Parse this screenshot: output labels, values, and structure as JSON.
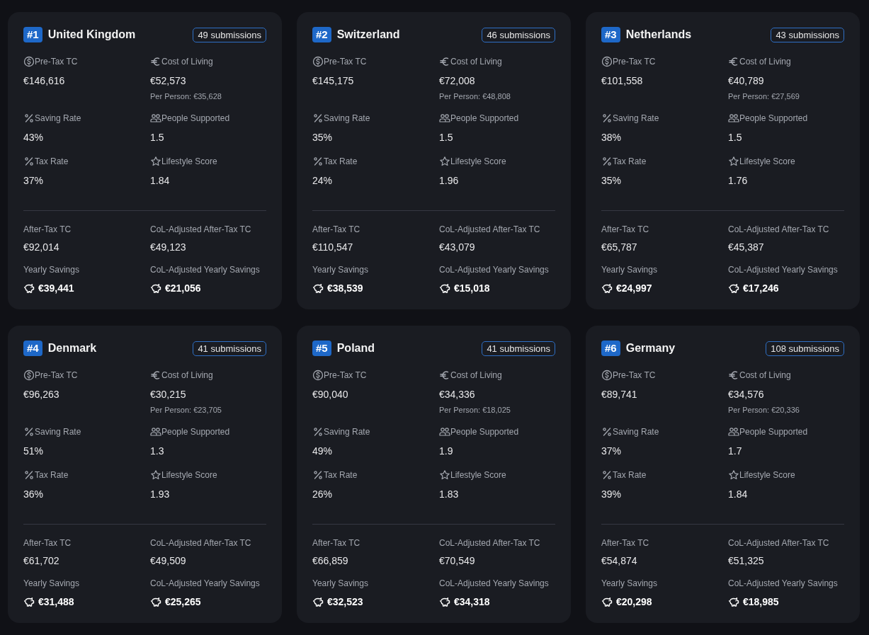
{
  "cards": [
    {
      "rank": "#1",
      "country": "United Kingdom",
      "submissions": "49 submissions",
      "metrics": [
        {
          "kind": "dollar",
          "label": "Pre-Tax TC",
          "value": "€146,616"
        },
        {
          "kind": "euro",
          "label": "Cost of Living",
          "value": "€52,573",
          "note": "Per Person: €35,628"
        },
        {
          "kind": "percent",
          "label": "Saving Rate",
          "value": "43%"
        },
        {
          "kind": "people",
          "label": "People Supported",
          "value": "1.5"
        },
        {
          "kind": "percent",
          "label": "Tax Rate",
          "value": "37%"
        },
        {
          "kind": "star",
          "label": "Lifestyle Score",
          "value": "1.84"
        }
      ],
      "summary": [
        {
          "kind": "plain",
          "label": "After-Tax TC",
          "value": "€92,014"
        },
        {
          "kind": "plain",
          "label": "CoL-Adjusted After-Tax TC",
          "value": "€49,123"
        },
        {
          "kind": "savings",
          "label": "Yearly Savings",
          "value": "€39,441"
        },
        {
          "kind": "savings",
          "label": "CoL-Adjusted Yearly Savings",
          "value": "€21,056"
        }
      ]
    },
    {
      "rank": "#2",
      "country": "Switzerland",
      "submissions": "46 submissions",
      "metrics": [
        {
          "kind": "dollar",
          "label": "Pre-Tax TC",
          "value": "€145,175"
        },
        {
          "kind": "euro",
          "label": "Cost of Living",
          "value": "€72,008",
          "note": "Per Person: €48,808"
        },
        {
          "kind": "percent",
          "label": "Saving Rate",
          "value": "35%"
        },
        {
          "kind": "people",
          "label": "People Supported",
          "value": "1.5"
        },
        {
          "kind": "percent",
          "label": "Tax Rate",
          "value": "24%"
        },
        {
          "kind": "star",
          "label": "Lifestyle Score",
          "value": "1.96"
        }
      ],
      "summary": [
        {
          "kind": "plain",
          "label": "After-Tax TC",
          "value": "€110,547"
        },
        {
          "kind": "plain",
          "label": "CoL-Adjusted After-Tax TC",
          "value": "€43,079"
        },
        {
          "kind": "savings",
          "label": "Yearly Savings",
          "value": "€38,539"
        },
        {
          "kind": "savings",
          "label": "CoL-Adjusted Yearly Savings",
          "value": "€15,018"
        }
      ]
    },
    {
      "rank": "#3",
      "country": "Netherlands",
      "submissions": "43 submissions",
      "metrics": [
        {
          "kind": "dollar",
          "label": "Pre-Tax TC",
          "value": "€101,558"
        },
        {
          "kind": "euro",
          "label": "Cost of Living",
          "value": "€40,789",
          "note": "Per Person: €27,569"
        },
        {
          "kind": "percent",
          "label": "Saving Rate",
          "value": "38%"
        },
        {
          "kind": "people",
          "label": "People Supported",
          "value": "1.5"
        },
        {
          "kind": "percent",
          "label": "Tax Rate",
          "value": "35%"
        },
        {
          "kind": "star",
          "label": "Lifestyle Score",
          "value": "1.76"
        }
      ],
      "summary": [
        {
          "kind": "plain",
          "label": "After-Tax TC",
          "value": "€65,787"
        },
        {
          "kind": "plain",
          "label": "CoL-Adjusted After-Tax TC",
          "value": "€45,387"
        },
        {
          "kind": "savings",
          "label": "Yearly Savings",
          "value": "€24,997"
        },
        {
          "kind": "savings",
          "label": "CoL-Adjusted Yearly Savings",
          "value": "€17,246"
        }
      ]
    },
    {
      "rank": "#4",
      "country": "Denmark",
      "submissions": "41 submissions",
      "metrics": [
        {
          "kind": "dollar",
          "label": "Pre-Tax TC",
          "value": "€96,263"
        },
        {
          "kind": "euro",
          "label": "Cost of Living",
          "value": "€30,215",
          "note": "Per Person: €23,705"
        },
        {
          "kind": "percent",
          "label": "Saving Rate",
          "value": "51%"
        },
        {
          "kind": "people",
          "label": "People Supported",
          "value": "1.3"
        },
        {
          "kind": "percent",
          "label": "Tax Rate",
          "value": "36%"
        },
        {
          "kind": "star",
          "label": "Lifestyle Score",
          "value": "1.93"
        }
      ],
      "summary": [
        {
          "kind": "plain",
          "label": "After-Tax TC",
          "value": "€61,702"
        },
        {
          "kind": "plain",
          "label": "CoL-Adjusted After-Tax TC",
          "value": "€49,509"
        },
        {
          "kind": "savings",
          "label": "Yearly Savings",
          "value": "€31,488"
        },
        {
          "kind": "savings",
          "label": "CoL-Adjusted Yearly Savings",
          "value": "€25,265"
        }
      ]
    },
    {
      "rank": "#5",
      "country": "Poland",
      "submissions": "41 submissions",
      "metrics": [
        {
          "kind": "dollar",
          "label": "Pre-Tax TC",
          "value": "€90,040"
        },
        {
          "kind": "euro",
          "label": "Cost of Living",
          "value": "€34,336",
          "note": "Per Person: €18,025"
        },
        {
          "kind": "percent",
          "label": "Saving Rate",
          "value": "49%"
        },
        {
          "kind": "people",
          "label": "People Supported",
          "value": "1.9"
        },
        {
          "kind": "percent",
          "label": "Tax Rate",
          "value": "26%"
        },
        {
          "kind": "star",
          "label": "Lifestyle Score",
          "value": "1.83"
        }
      ],
      "summary": [
        {
          "kind": "plain",
          "label": "After-Tax TC",
          "value": "€66,859"
        },
        {
          "kind": "plain",
          "label": "CoL-Adjusted After-Tax TC",
          "value": "€70,549"
        },
        {
          "kind": "savings",
          "label": "Yearly Savings",
          "value": "€32,523"
        },
        {
          "kind": "savings",
          "label": "CoL-Adjusted Yearly Savings",
          "value": "€34,318"
        }
      ]
    },
    {
      "rank": "#6",
      "country": "Germany",
      "submissions": "108 submissions",
      "metrics": [
        {
          "kind": "dollar",
          "label": "Pre-Tax TC",
          "value": "€89,741"
        },
        {
          "kind": "euro",
          "label": "Cost of Living",
          "value": "€34,576",
          "note": "Per Person: €20,336"
        },
        {
          "kind": "percent",
          "label": "Saving Rate",
          "value": "37%"
        },
        {
          "kind": "people",
          "label": "People Supported",
          "value": "1.7"
        },
        {
          "kind": "percent",
          "label": "Tax Rate",
          "value": "39%"
        },
        {
          "kind": "star",
          "label": "Lifestyle Score",
          "value": "1.84"
        }
      ],
      "summary": [
        {
          "kind": "plain",
          "label": "After-Tax TC",
          "value": "€54,874"
        },
        {
          "kind": "plain",
          "label": "CoL-Adjusted After-Tax TC",
          "value": "€51,325"
        },
        {
          "kind": "savings",
          "label": "Yearly Savings",
          "value": "€20,298"
        },
        {
          "kind": "savings",
          "label": "CoL-Adjusted Yearly Savings",
          "value": "€18,985"
        }
      ]
    }
  ]
}
